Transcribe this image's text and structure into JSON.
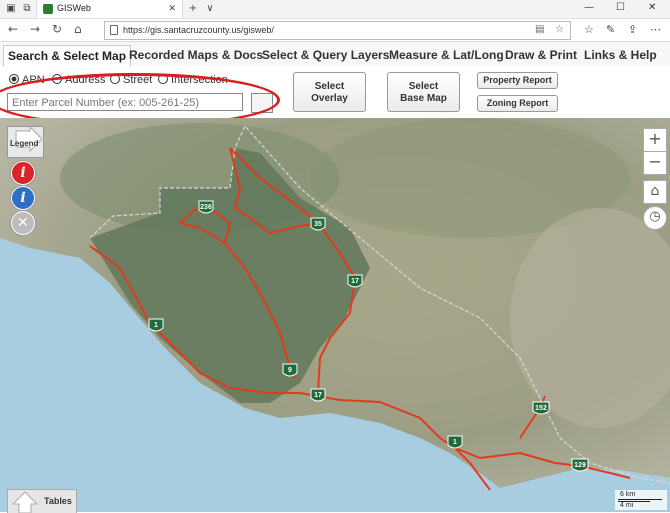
{
  "browser": {
    "tab_title": "GISWeb",
    "tab_close": "✕",
    "new_tab": "+",
    "tab_menu": "∨",
    "url": "https://gis.santacruzcounty.us/gisweb/"
  },
  "menu": {
    "items": [
      {
        "label": "Search & Select Map"
      },
      {
        "label": "Recorded Maps & Docs"
      },
      {
        "label": "Select & Query Layers"
      },
      {
        "label": "Measure & Lat/Long"
      },
      {
        "label": "Draw & Print"
      },
      {
        "label": "Links & Help"
      }
    ]
  },
  "search": {
    "radio": [
      {
        "label": "APN",
        "selected": true
      },
      {
        "label": "Address",
        "selected": false
      },
      {
        "label": "Street",
        "selected": false
      },
      {
        "label": "Intersection",
        "selected": false
      }
    ],
    "placeholder": "Enter Parcel Number (ex: 005-261-25)"
  },
  "buttons": {
    "overlay_line1": "Select",
    "overlay_line2": "Overlay",
    "basemap_line1": "Select",
    "basemap_line2": "Base Map",
    "property_report": "Property Report",
    "zoning_report": "Zoning Report"
  },
  "map": {
    "legend_label": "Legend",
    "tables_label": "Tables",
    "scale_km": "6 km",
    "scale_mi": "4 mi",
    "zoom_in": "+",
    "zoom_out": "−",
    "shields": [
      "236",
      "35",
      "17",
      "1",
      "9",
      "17",
      "152",
      "1",
      "129"
    ]
  },
  "colors": {
    "road": "#e23a1f",
    "identify_red": "#d9252a",
    "identify_blue": "#2f6fc4",
    "clear_gray": "#bdbdbd"
  }
}
